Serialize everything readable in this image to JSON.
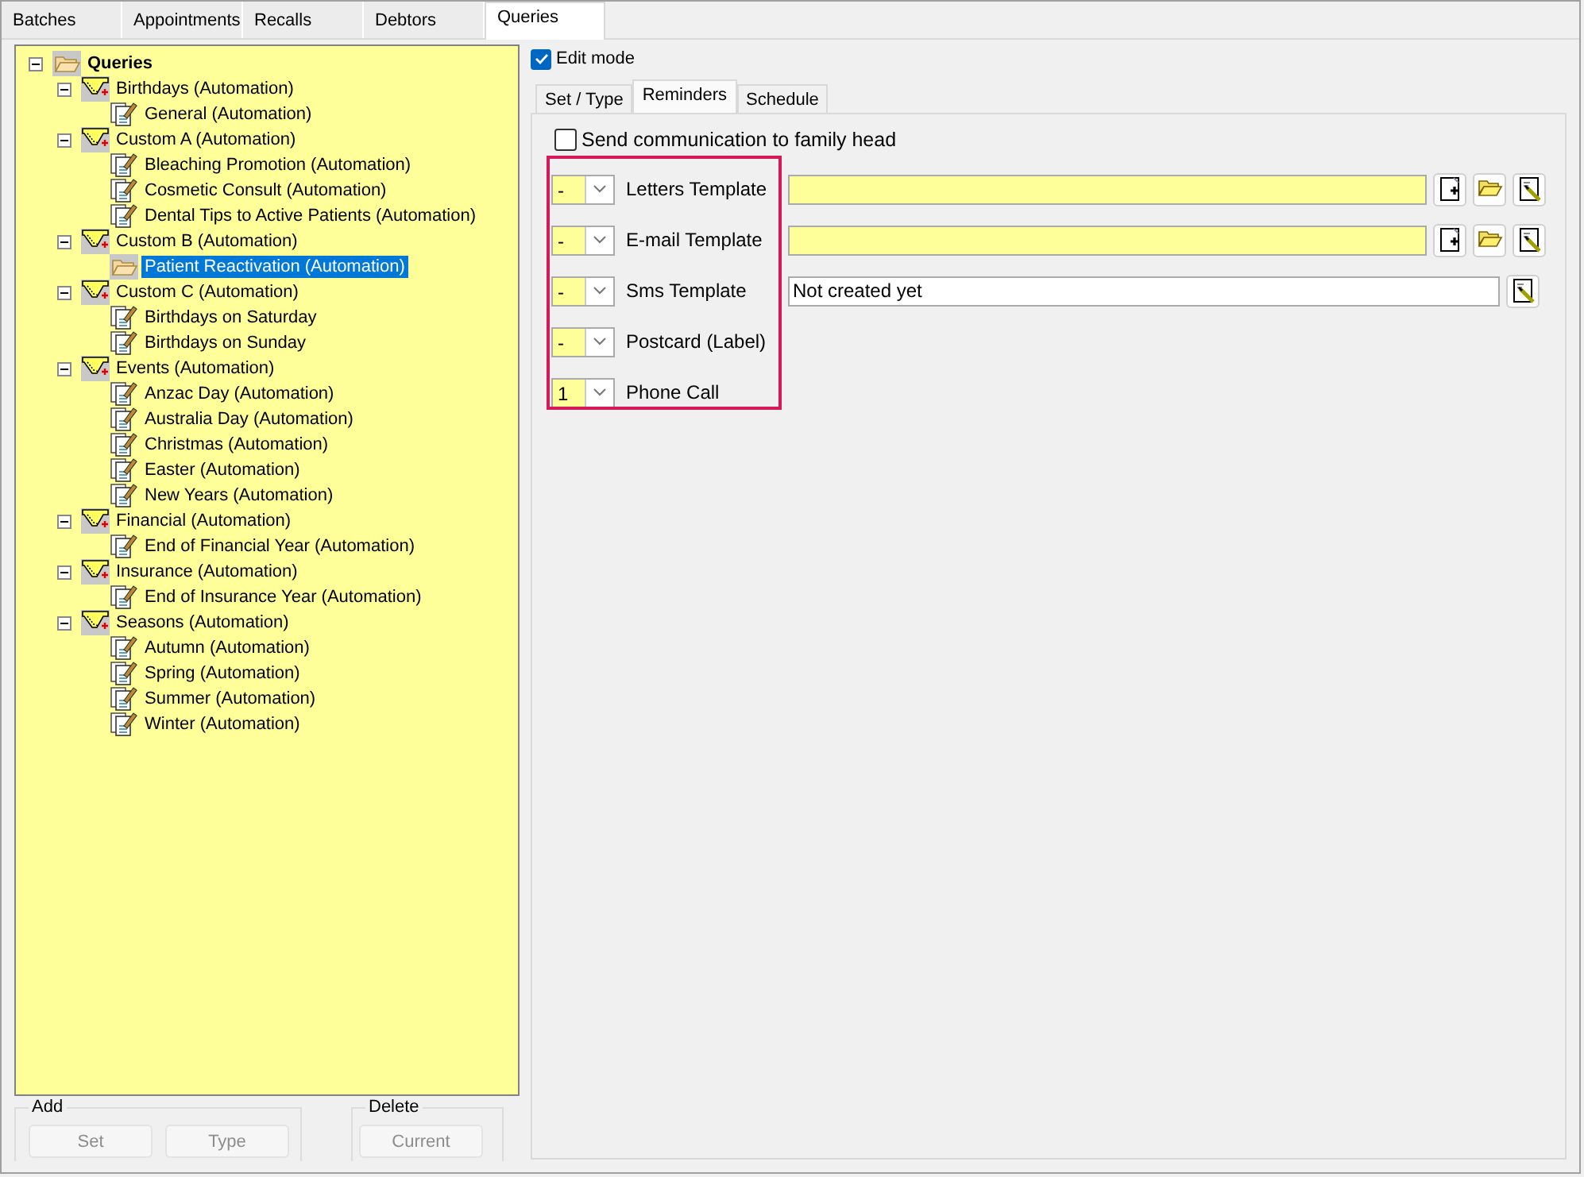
{
  "top_tabs": [
    {
      "label": "Batches",
      "selected": false
    },
    {
      "label": "Appointments",
      "selected": false
    },
    {
      "label": "Recalls",
      "selected": false
    },
    {
      "label": "Debtors",
      "selected": false
    },
    {
      "label": "Queries",
      "selected": true
    }
  ],
  "tree": [
    {
      "label": "Queries",
      "kind": "folder",
      "expanded": true,
      "selected": false,
      "children": [
        {
          "label": "Birthdays (Automation)",
          "kind": "group",
          "expanded": true,
          "selected": false,
          "children": [
            {
              "label": "General (Automation)",
              "kind": "document",
              "selected": false
            }
          ]
        },
        {
          "label": "Custom A (Automation)",
          "kind": "group",
          "expanded": true,
          "selected": false,
          "children": [
            {
              "label": "Bleaching Promotion (Automation)",
              "kind": "document",
              "selected": false
            },
            {
              "label": "Cosmetic Consult (Automation)",
              "kind": "document",
              "selected": false
            },
            {
              "label": "Dental Tips to Active Patients (Automation)",
              "kind": "document",
              "selected": false
            }
          ]
        },
        {
          "label": "Custom B (Automation)",
          "kind": "group",
          "expanded": true,
          "selected": false,
          "children": [
            {
              "label": "Patient Reactivation (Automation)",
              "kind": "folder",
              "selected": true
            }
          ]
        },
        {
          "label": "Custom C (Automation)",
          "kind": "group",
          "expanded": true,
          "selected": false,
          "children": [
            {
              "label": "Birthdays on Saturday",
              "kind": "document",
              "selected": false
            },
            {
              "label": "Birthdays on Sunday",
              "kind": "document",
              "selected": false
            }
          ]
        },
        {
          "label": "Events (Automation)",
          "kind": "group",
          "expanded": true,
          "selected": false,
          "children": [
            {
              "label": "Anzac Day (Automation)",
              "kind": "document",
              "selected": false
            },
            {
              "label": "Australia Day (Automation)",
              "kind": "document",
              "selected": false
            },
            {
              "label": "Christmas (Automation)",
              "kind": "document",
              "selected": false
            },
            {
              "label": "Easter (Automation)",
              "kind": "document",
              "selected": false
            },
            {
              "label": "New Years (Automation)",
              "kind": "document",
              "selected": false
            }
          ]
        },
        {
          "label": "Financial (Automation)",
          "kind": "group",
          "expanded": true,
          "selected": false,
          "children": [
            {
              "label": "End of Financial Year (Automation)",
              "kind": "document",
              "selected": false
            }
          ]
        },
        {
          "label": "Insurance (Automation)",
          "kind": "group",
          "expanded": true,
          "selected": false,
          "children": [
            {
              "label": "End of Insurance Year (Automation)",
              "kind": "document",
              "selected": false
            }
          ]
        },
        {
          "label": "Seasons (Automation)",
          "kind": "group",
          "expanded": true,
          "selected": false,
          "children": [
            {
              "label": "Autumn (Automation)",
              "kind": "document",
              "selected": false
            },
            {
              "label": "Spring (Automation)",
              "kind": "document",
              "selected": false
            },
            {
              "label": "Summer (Automation)",
              "kind": "document",
              "selected": false
            },
            {
              "label": "Winter (Automation)",
              "kind": "document",
              "selected": false
            }
          ]
        }
      ]
    }
  ],
  "add_group": {
    "title": "Add",
    "buttons": [
      {
        "label": "Set",
        "disabled": true
      },
      {
        "label": "Type",
        "disabled": true
      }
    ]
  },
  "delete_group": {
    "title": "Delete",
    "buttons": [
      {
        "label": "Current",
        "disabled": true
      }
    ]
  },
  "edit_mode": {
    "label": "Edit mode",
    "checked": true
  },
  "sub_tabs": [
    {
      "label": "Set / Type",
      "selected": false
    },
    {
      "label": "Reminders",
      "selected": true
    },
    {
      "label": "Schedule",
      "selected": false
    }
  ],
  "family_head": {
    "label": "Send communication to family head",
    "checked": false
  },
  "reminders": {
    "highlighted": true,
    "rows": [
      {
        "order": "-",
        "label": "Letters Template",
        "field": {
          "kind": "required"
        },
        "new_button": true,
        "open_button": true,
        "edit_button": true
      },
      {
        "order": "-",
        "label": "E-mail Template",
        "field": {
          "kind": "required"
        },
        "new_button": true,
        "open_button": true,
        "edit_button": true
      },
      {
        "order": "-",
        "label": "Sms Template",
        "field": {
          "kind": "plain",
          "value": "Not created yet"
        },
        "new_button": false,
        "open_button": false,
        "edit_button": true
      },
      {
        "order": "-",
        "label": "Postcard (Label)",
        "new_button": false,
        "open_button": false,
        "edit_button": false
      },
      {
        "order": "1",
        "label": "Phone Call",
        "new_button": false,
        "open_button": false,
        "edit_button": false
      }
    ]
  }
}
